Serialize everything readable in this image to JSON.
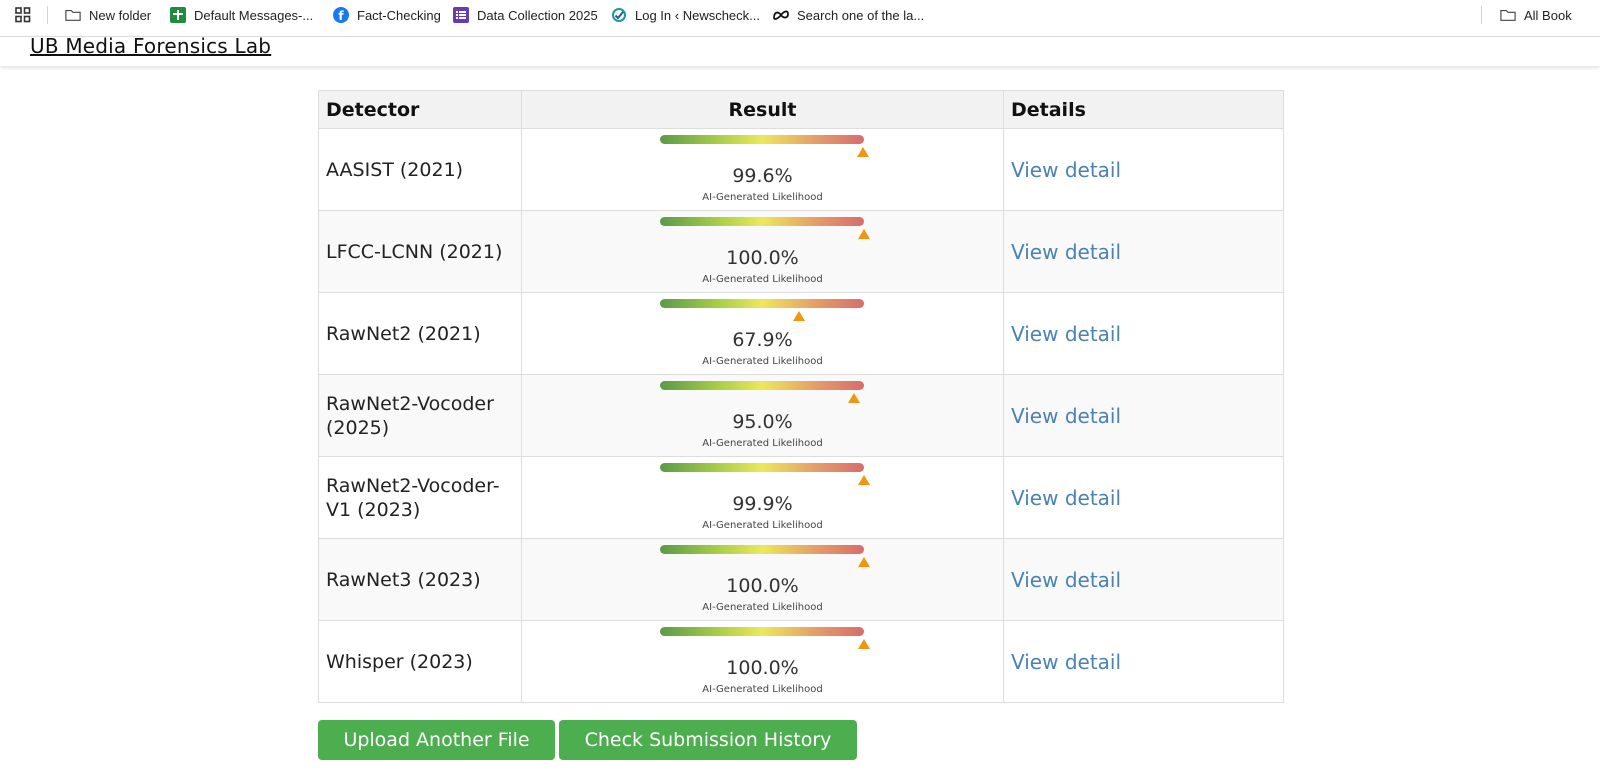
{
  "bookmarks": {
    "items": [
      {
        "label": "New folder",
        "icon": "folder-icon"
      },
      {
        "label": "Default Messages-...",
        "icon": "sheets-icon",
        "color": "#1e8e3e"
      },
      {
        "label": "Fact-Checking",
        "icon": "facebook-icon",
        "color": "#1877f2"
      },
      {
        "label": "Data Collection 2025",
        "icon": "forms-icon",
        "color": "#673ab7"
      },
      {
        "label": "Log In ‹ Newscheck...",
        "icon": "newscheck-icon",
        "color": "#1a9b8c"
      },
      {
        "label": "Search one of the la...",
        "icon": "meta-icon",
        "color": "#111111"
      }
    ],
    "all_bookmarks": "All Book"
  },
  "site": {
    "title": "UB Media Forensics Lab"
  },
  "table": {
    "headers": {
      "detector": "Detector",
      "result": "Result",
      "details": "Details"
    },
    "caption": "AI-Generated Likelihood",
    "link_label": "View detail",
    "rows": [
      {
        "detector": "AASIST (2021)",
        "percent": "99.6%",
        "likelihood": 0.996
      },
      {
        "detector": "LFCC-LCNN (2021)",
        "percent": "100.0%",
        "likelihood": 1.0
      },
      {
        "detector": "RawNet2 (2021)",
        "percent": "67.9%",
        "likelihood": 0.679
      },
      {
        "detector": "RawNet2-Vocoder (2025)",
        "percent": "95.0%",
        "likelihood": 0.95
      },
      {
        "detector": "RawNet2-Vocoder-V1 (2023)",
        "percent": "99.9%",
        "likelihood": 0.999
      },
      {
        "detector": "RawNet3 (2023)",
        "percent": "100.0%",
        "likelihood": 1.0
      },
      {
        "detector": "Whisper (2023)",
        "percent": "100.0%",
        "likelihood": 1.0
      }
    ]
  },
  "actions": {
    "upload_label": "Upload Another File",
    "history_label": "Check Submission History"
  },
  "colors": {
    "button_green": "#4cae4f",
    "link_blue": "#4a82b4",
    "marker_orange": "#f0960f"
  }
}
